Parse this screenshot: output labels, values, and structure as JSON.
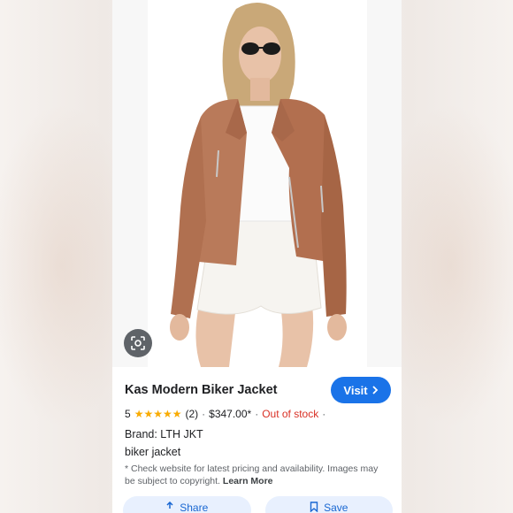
{
  "product": {
    "title": "Kas Modern Biker Jacket",
    "visit_label": "Visit",
    "rating_value": "5",
    "stars": "★★★★★",
    "review_count": "(2)",
    "price": "$347.00*",
    "stock_status": "Out of stock",
    "brand": "Brand: LTH JKT",
    "description": "biker jacket",
    "note": "* Check website for latest pricing and availability. Images may be subject to copyright.",
    "learn_more": "Learn More"
  },
  "actions": {
    "share_label": "Share",
    "save_label": "Save"
  },
  "icons": {
    "lens": "google-lens-icon",
    "visit_arrow": "chevron-right-icon",
    "share": "share-icon",
    "save": "bookmark-icon"
  },
  "colors": {
    "accent": "#1a73e8",
    "out_of_stock": "#d93025",
    "stars": "#f9ab00",
    "jacket": "#b97a5a"
  }
}
